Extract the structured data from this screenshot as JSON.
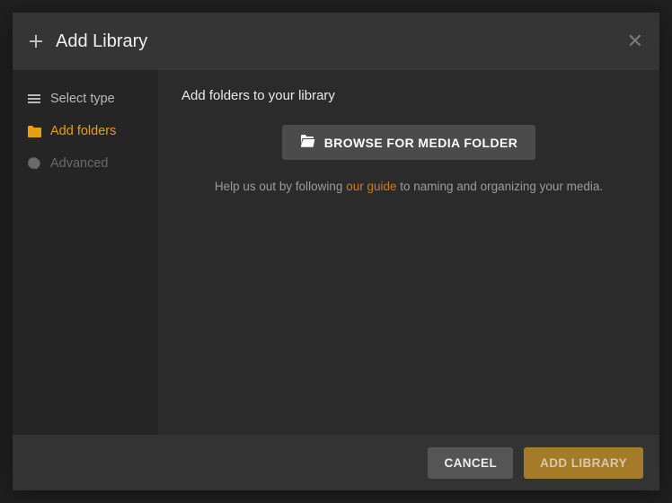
{
  "header": {
    "title": "Add Library"
  },
  "sidebar": {
    "items": [
      {
        "label": "Select type"
      },
      {
        "label": "Add folders"
      },
      {
        "label": "Advanced"
      }
    ]
  },
  "content": {
    "heading": "Add folders to your library",
    "browse_label": "BROWSE FOR MEDIA FOLDER",
    "help_prefix": "Help us out by following ",
    "help_link": "our guide",
    "help_suffix": " to naming and organizing your media."
  },
  "footer": {
    "cancel_label": "CANCEL",
    "confirm_label": "ADD LIBRARY"
  }
}
